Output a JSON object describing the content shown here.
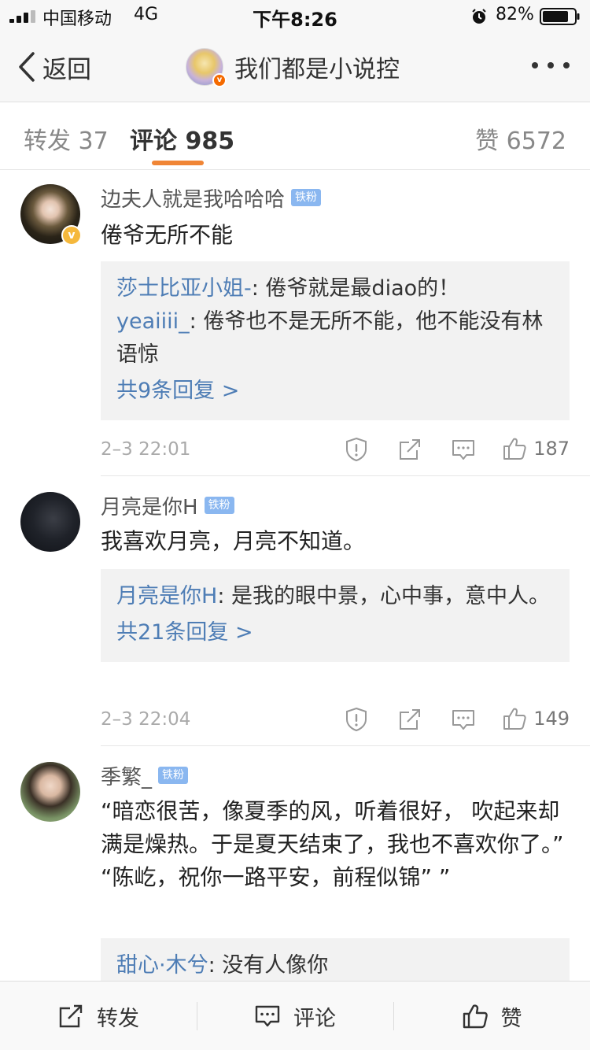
{
  "status_bar": {
    "carrier": "中国移动",
    "network": "4G",
    "time": "下午8:26",
    "battery": "82%",
    "battery_level": 0.82
  },
  "nav": {
    "back_label": "返回",
    "title": "我们都是小说控"
  },
  "tabs": [
    {
      "label": "转发 37"
    },
    {
      "label": "评论 985"
    },
    {
      "label": "赞 6572"
    }
  ],
  "comments": [
    {
      "user": "边夫人就是我哈哈哈",
      "badge": "铁粉",
      "text": "倦爷无所不能",
      "replies": [
        {
          "user": "莎士比亚小姐-",
          "text": ": 倦爷就是最diao的！"
        },
        {
          "user": "yeaiiii_",
          "text": ": 倦爷也不是无所不能，他不能没有林语惊"
        }
      ],
      "more_replies": "共9条回复 >",
      "time": "2–3 22:01",
      "likes": "187"
    },
    {
      "user": "月亮是你H",
      "badge": "铁粉",
      "text": "我喜欢月亮，月亮不知道。",
      "replies": [
        {
          "user": "月亮是你H",
          "text": ": 是我的眼中景，心中事，意中人。"
        }
      ],
      "more_replies": "共21条回复 >",
      "time": "2–3 22:04",
      "likes": "149"
    },
    {
      "user": "季繁_",
      "badge": "铁粉",
      "text": "“暗恋很苦，像夏季的风，听着很好，  吹起来却满是燥热。于是夏天结束了，我也不喜欢你了。” “陈屹，祝你一路平安，前程似锦” ”",
      "replies": [
        {
          "user": "甜心·木兮",
          "text": ": 没有人像你"
        }
      ]
    }
  ],
  "bottom_bar": {
    "repost": "转发",
    "comment": "评论",
    "like": "赞"
  },
  "colors": {
    "accent": "#f08535",
    "link": "#4e7db5",
    "fan_badge": "#8ab7f0",
    "verified_gold": "#f5b83c",
    "verified_orange": "#f56a00"
  }
}
